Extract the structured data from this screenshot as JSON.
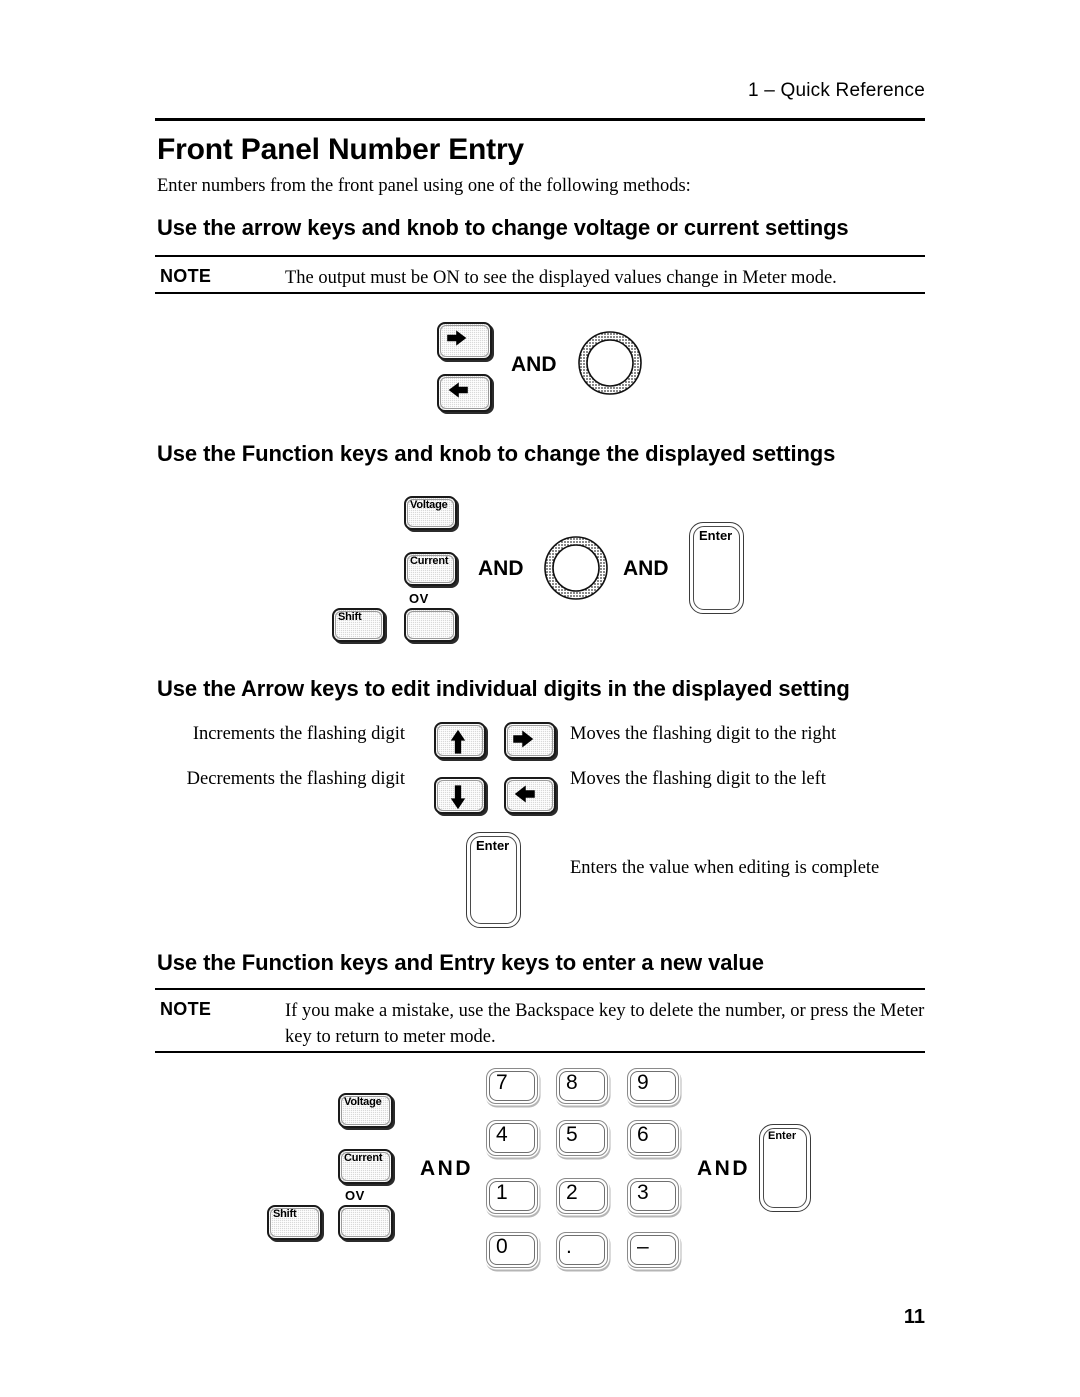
{
  "header": {
    "running_head": "1 – Quick Reference"
  },
  "title": "Front Panel Number Entry",
  "intro": "Enter numbers from the front panel using one of the following methods:",
  "sections": {
    "arrow_knob": {
      "heading": "Use the arrow keys and knob to change voltage or current settings",
      "note_label": "NOTE",
      "note_text": "The output must be ON to see the displayed values change in Meter mode.",
      "and_1": "AND",
      "keys": {
        "right_arrow": "right-arrow",
        "left_arrow": "left-arrow",
        "knob": "rotary-knob"
      }
    },
    "function_knob": {
      "heading": "Use the Function keys and knob to change the displayed settings",
      "and_1": "AND",
      "and_2": "AND",
      "keys": {
        "voltage": "Voltage",
        "current": "Current",
        "shift": "Shift",
        "ov_label": "OV",
        "ov_key": "",
        "enter": "Enter"
      }
    },
    "edit_digits": {
      "heading": "Use the Arrow keys to edit individual digits in the displayed setting",
      "rows": [
        {
          "left_desc": "Increments the flashing digit",
          "left_key": "up-arrow",
          "right_key": "right-arrow",
          "right_desc": "Moves the flashing digit to the right"
        },
        {
          "left_desc": "Decrements the flashing digit",
          "left_key": "down-arrow",
          "right_key": "left-arrow",
          "right_desc": "Moves the flashing digit to the left"
        }
      ],
      "enter_key_label": "Enter",
      "enter_desc": "Enters the value when editing is complete"
    },
    "entry_keys": {
      "heading": "Use the Function keys and Entry keys to enter a new value",
      "note_label": "NOTE",
      "note_text": "If you make a mistake, use the Backspace key to delete the number, or press the Meter key to return to meter mode.",
      "and_1": "AND",
      "and_2": "AND",
      "keys": {
        "voltage": "Voltage",
        "current": "Current",
        "shift": "Shift",
        "ov_label": "OV",
        "ov_key": "",
        "enter": "Enter"
      },
      "keypad": [
        [
          "7",
          "8",
          "9"
        ],
        [
          "4",
          "5",
          "6"
        ],
        [
          "1",
          "2",
          "3"
        ],
        [
          "0",
          ".",
          "–"
        ]
      ]
    }
  },
  "footer": {
    "page_number": "11"
  },
  "colors": {
    "text": "#000000",
    "page_background": "#ffffff",
    "key_grey": "#d9d9d9",
    "key_white": "#ffffff",
    "rule": "#000000"
  }
}
